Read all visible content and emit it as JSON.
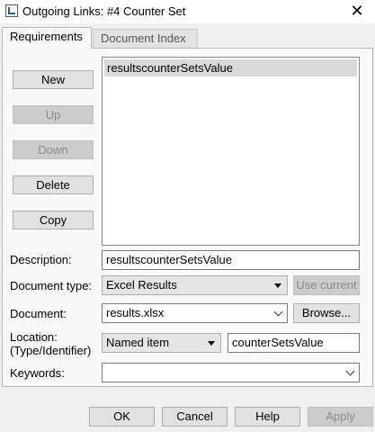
{
  "window": {
    "title": "Outgoing Links: #4 Counter Set",
    "close_glyph": "✕"
  },
  "tabs": [
    {
      "label": "Requirements",
      "active": true
    },
    {
      "label": "Document Index",
      "active": false
    }
  ],
  "side_buttons": {
    "new": "New",
    "up": "Up",
    "down": "Down",
    "delete": "Delete",
    "copy": "Copy"
  },
  "requirements_list": {
    "items": [
      "resultscounterSetsValue"
    ],
    "selected_index": 0
  },
  "form": {
    "description": {
      "label": "Description:",
      "value": "resultscounterSetsValue"
    },
    "document_type": {
      "label": "Document type:",
      "value": "Excel Results",
      "use_current_label": "Use current"
    },
    "document": {
      "label": "Document:",
      "value": "results.xlsx",
      "browse_label": "Browse..."
    },
    "location": {
      "label_line1": "Location:",
      "label_line2": "(Type/Identifier)",
      "type_value": "Named item",
      "identifier_value": "counterSetsValue"
    },
    "keywords": {
      "label": "Keywords:",
      "value": ""
    }
  },
  "footer_buttons": {
    "ok": "OK",
    "cancel": "Cancel",
    "help": "Help",
    "apply": "Apply"
  }
}
